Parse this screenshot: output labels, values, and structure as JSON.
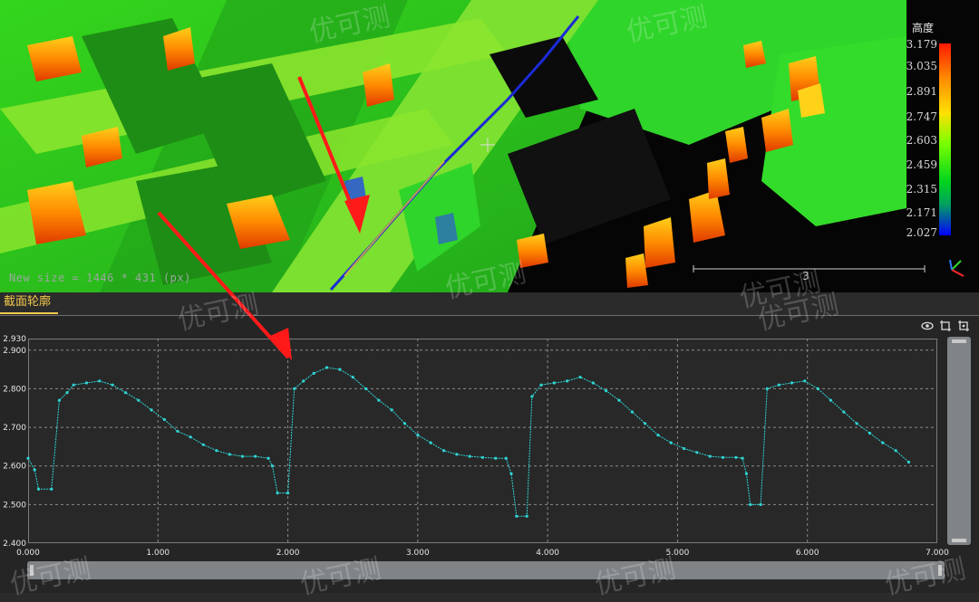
{
  "view3d": {
    "status_text": "New size = 1446 * 431 (px)",
    "scale_label": "3",
    "legend": {
      "title": "高度",
      "ticks": [
        "3.179",
        "3.035",
        "2.891",
        "2.747",
        "2.603",
        "2.459",
        "2.315",
        "2.171",
        "2.027"
      ]
    }
  },
  "profile_panel": {
    "tab_label": "截面轮廓",
    "icons": [
      "eye-icon",
      "crop-icon",
      "crop-reset-icon"
    ]
  },
  "watermark": "优可测",
  "colors": {
    "accent": "#f2c94c",
    "profile_line": "#2fd5d5",
    "cut_line": "#1a2bd6"
  },
  "chart_data": {
    "type": "line",
    "xlim": [
      0,
      7
    ],
    "ylim": [
      2.4,
      2.93
    ],
    "x_ticks": [
      "0.000",
      "1.000",
      "2.000",
      "3.000",
      "4.000",
      "5.000",
      "6.000",
      "7.000"
    ],
    "y_ticks": [
      "2.930",
      "2.900",
      "2.800",
      "2.700",
      "2.600",
      "2.500",
      "2.400"
    ],
    "grid": true,
    "series": [
      {
        "points": [
          [
            0.0,
            2.62
          ],
          [
            0.05,
            2.59
          ],
          [
            0.08,
            2.54
          ],
          [
            0.18,
            2.54
          ],
          [
            0.24,
            2.77
          ],
          [
            0.3,
            2.79
          ],
          [
            0.35,
            2.81
          ],
          [
            0.45,
            2.815
          ],
          [
            0.55,
            2.82
          ],
          [
            0.65,
            2.81
          ],
          [
            0.75,
            2.79
          ],
          [
            0.85,
            2.77
          ],
          [
            0.95,
            2.745
          ],
          [
            1.05,
            2.72
          ],
          [
            1.15,
            2.69
          ],
          [
            1.25,
            2.675
          ],
          [
            1.35,
            2.655
          ],
          [
            1.45,
            2.64
          ],
          [
            1.55,
            2.63
          ],
          [
            1.65,
            2.625
          ],
          [
            1.75,
            2.625
          ],
          [
            1.85,
            2.62
          ],
          [
            1.88,
            2.6
          ],
          [
            1.92,
            2.53
          ],
          [
            2.0,
            2.53
          ],
          [
            2.05,
            2.8
          ],
          [
            2.12,
            2.82
          ],
          [
            2.2,
            2.84
          ],
          [
            2.3,
            2.855
          ],
          [
            2.4,
            2.85
          ],
          [
            2.5,
            2.83
          ],
          [
            2.6,
            2.8
          ],
          [
            2.7,
            2.77
          ],
          [
            2.8,
            2.745
          ],
          [
            2.9,
            2.71
          ],
          [
            3.0,
            2.68
          ],
          [
            3.1,
            2.66
          ],
          [
            3.2,
            2.64
          ],
          [
            3.3,
            2.63
          ],
          [
            3.4,
            2.625
          ],
          [
            3.5,
            2.622
          ],
          [
            3.6,
            2.62
          ],
          [
            3.68,
            2.62
          ],
          [
            3.72,
            2.58
          ],
          [
            3.76,
            2.47
          ],
          [
            3.84,
            2.47
          ],
          [
            3.88,
            2.78
          ],
          [
            3.95,
            2.81
          ],
          [
            4.05,
            2.815
          ],
          [
            4.15,
            2.82
          ],
          [
            4.25,
            2.83
          ],
          [
            4.35,
            2.815
          ],
          [
            4.45,
            2.795
          ],
          [
            4.55,
            2.77
          ],
          [
            4.65,
            2.74
          ],
          [
            4.75,
            2.71
          ],
          [
            4.85,
            2.68
          ],
          [
            4.95,
            2.66
          ],
          [
            5.05,
            2.645
          ],
          [
            5.15,
            2.635
          ],
          [
            5.25,
            2.625
          ],
          [
            5.35,
            2.622
          ],
          [
            5.45,
            2.622
          ],
          [
            5.5,
            2.62
          ],
          [
            5.53,
            2.58
          ],
          [
            5.56,
            2.5
          ],
          [
            5.64,
            2.5
          ],
          [
            5.69,
            2.8
          ],
          [
            5.78,
            2.81
          ],
          [
            5.88,
            2.815
          ],
          [
            5.98,
            2.82
          ],
          [
            6.08,
            2.8
          ],
          [
            6.18,
            2.77
          ],
          [
            6.28,
            2.74
          ],
          [
            6.38,
            2.71
          ],
          [
            6.48,
            2.685
          ],
          [
            6.58,
            2.66
          ],
          [
            6.68,
            2.64
          ],
          [
            6.78,
            2.61
          ]
        ]
      }
    ]
  }
}
